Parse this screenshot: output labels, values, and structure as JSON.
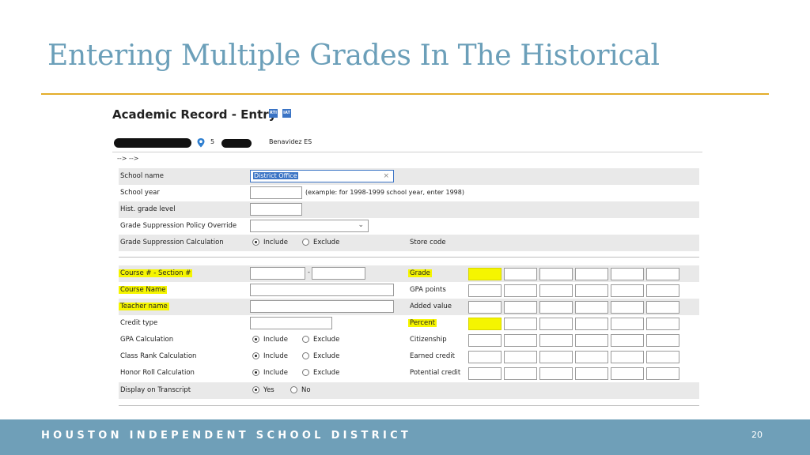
{
  "slide": {
    "title": "Entering Multiple Grades In The Historical",
    "footer": "HOUSTON INDEPENDENT SCHOOL DISTRICT",
    "page_number": "20",
    "accent_color": "#e3ad2a",
    "footer_color": "#6f9fb8"
  },
  "screen": {
    "heading": "Academic Record - Entry",
    "badges": [
      "RTI",
      "IAT"
    ],
    "student": {
      "grade": "5",
      "school": "Benavidez ES"
    },
    "breadcrumb": "-->  -->",
    "fields": {
      "school_name": {
        "label": "School name",
        "value": "District Office"
      },
      "school_year": {
        "label": "School year",
        "value": "",
        "hint": "(example: for 1998-1999 school year, enter 1998)"
      },
      "hist_grade_level": {
        "label": "Hist. grade level",
        "value": ""
      },
      "grade_suppression_override": {
        "label": "Grade Suppression Policy Override",
        "value": ""
      },
      "grade_suppression_calc": {
        "label": "Grade Suppression Calculation",
        "include": "Include",
        "exclude": "Exclude",
        "selected": "Include",
        "store_code_label": "Store code"
      }
    },
    "course_fields": {
      "course_section": {
        "label": "Course # - Section #",
        "separator": "-"
      },
      "course_name": {
        "label": "Course Name"
      },
      "teacher_name": {
        "label": "Teacher name"
      },
      "credit_type": {
        "label": "Credit type"
      },
      "gpa_calc": {
        "label": "GPA Calculation",
        "include": "Include",
        "exclude": "Exclude",
        "selected": "Include"
      },
      "class_rank_calc": {
        "label": "Class Rank Calculation",
        "include": "Include",
        "exclude": "Exclude",
        "selected": "Include"
      },
      "honor_roll_calc": {
        "label": "Honor Roll Calculation",
        "include": "Include",
        "exclude": "Exclude",
        "selected": "Include"
      },
      "display_transcript": {
        "label": "Display on Transcript",
        "yes": "Yes",
        "no": "No",
        "selected": "Yes"
      }
    },
    "store_fields": [
      "Grade",
      "GPA points",
      "Added value",
      "Percent",
      "Citizenship",
      "Earned credit",
      "Potential credit"
    ],
    "highlighted_labels": [
      "Course # - Section #",
      "Course Name",
      "Teacher name",
      "Grade",
      "Percent"
    ]
  }
}
